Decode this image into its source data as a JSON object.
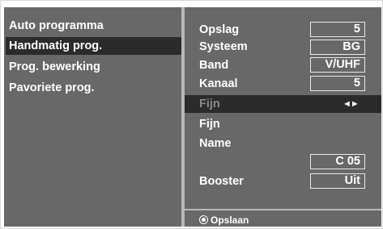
{
  "left_menu": {
    "items": [
      {
        "label": "Auto programma",
        "selected": false
      },
      {
        "label": "Handmatig prog.",
        "selected": true
      },
      {
        "label": "Prog. bewerking",
        "selected": false
      },
      {
        "label": "Pavoriete prog.",
        "selected": false
      }
    ]
  },
  "right_menu": {
    "opslag": {
      "label": "Opslag",
      "value": "5"
    },
    "systeem": {
      "label": "Systeem",
      "value": "BG"
    },
    "band": {
      "label": "Band",
      "value": "V/UHF"
    },
    "kanaal": {
      "label": "Kanaal",
      "value": "5"
    },
    "fijn_highlight": {
      "label": "Fijn",
      "arrows": "◄►"
    },
    "fijn": {
      "label": "Fijn"
    },
    "name": {
      "label": "Name",
      "value": "C 05"
    },
    "booster": {
      "label": "Booster",
      "value": "Uit"
    }
  },
  "footer": {
    "hint": "Opslaan",
    "icon": "ok-button-icon"
  },
  "colors": {
    "panel": "#686868",
    "highlight": "#2b2b2b",
    "divider": "#b8b8b8",
    "text": "#ffffff"
  }
}
